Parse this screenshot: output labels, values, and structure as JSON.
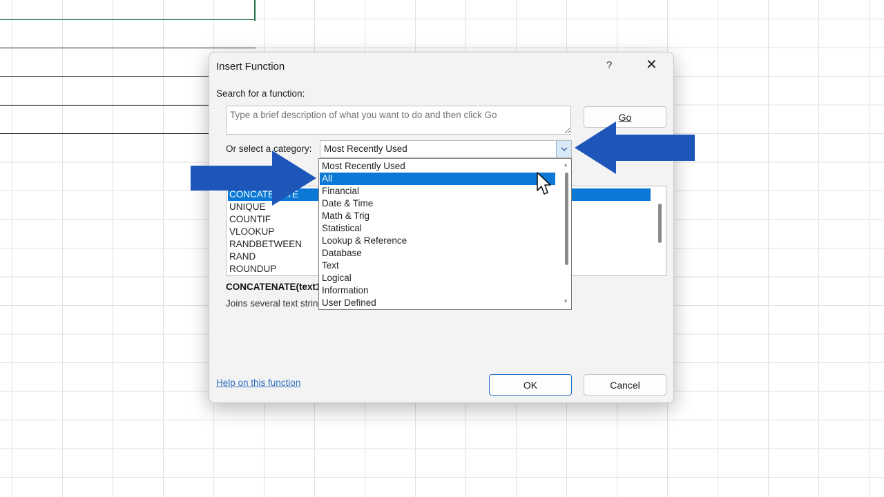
{
  "dialog": {
    "title": "Insert Function",
    "help_button": "?",
    "close_button": "✕",
    "search_label": "Search for a function:",
    "search_placeholder": "Type a brief description of what you want to do and then click Go",
    "go_button": "Go",
    "category_label": "Or select a category:",
    "category_value": "Most Recently Used",
    "function_list": [
      "CONCATENATE",
      "UNIQUE",
      "COUNTIF",
      "VLOOKUP",
      "RANDBETWEEN",
      "RAND",
      "ROUNDUP"
    ],
    "selected_function": "CONCATENATE",
    "syntax": "CONCATENATE(text1",
    "description": "Joins several text strin",
    "help_link": "Help on this function",
    "ok_button": "OK",
    "cancel_button": "Cancel"
  },
  "category_dropdown": {
    "options": [
      "Most Recently Used",
      "All",
      "Financial",
      "Date & Time",
      "Math & Trig",
      "Statistical",
      "Lookup & Reference",
      "Database",
      "Text",
      "Logical",
      "Information",
      "User Defined"
    ],
    "highlighted": "All"
  },
  "colors": {
    "selection": "#0a78d4",
    "arrow": "#1d56b8",
    "link": "#2f6fbf"
  },
  "icons": {
    "combo_arrow": "chevron-down-icon",
    "cursor": "mouse-pointer-icon",
    "close": "close-icon"
  }
}
